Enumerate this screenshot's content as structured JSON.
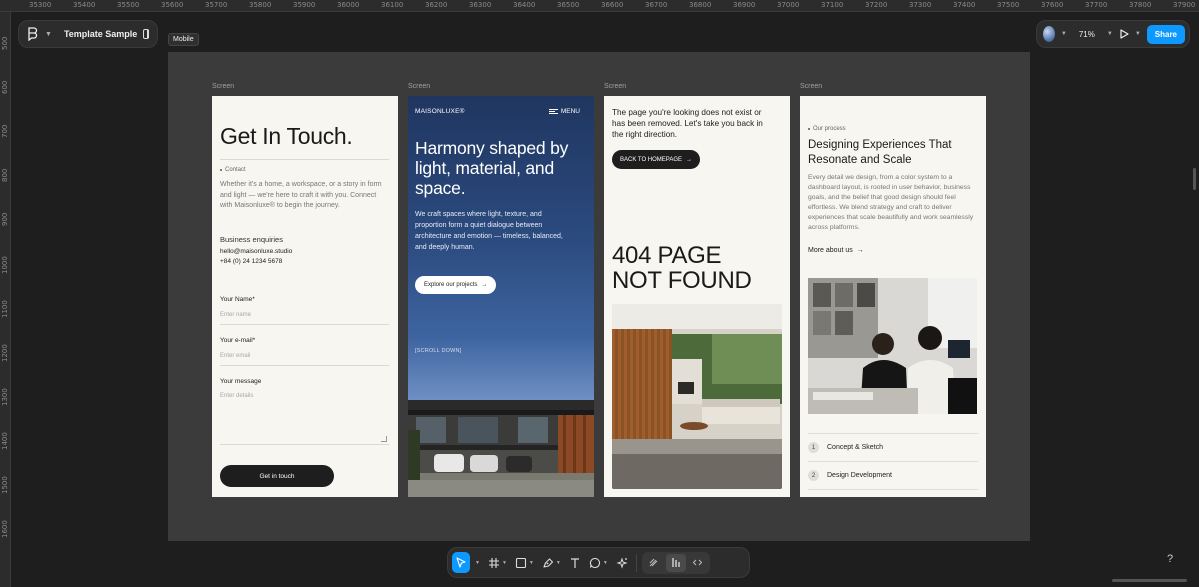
{
  "ruler": {
    "top": [
      "35300",
      "35400",
      "35500",
      "35600",
      "35700",
      "35800",
      "35900",
      "36000",
      "36100",
      "36200",
      "36300",
      "36400",
      "36500",
      "36600",
      "36700",
      "36800",
      "36900",
      "37000",
      "37100",
      "37200",
      "37300",
      "37400",
      "37500",
      "37600",
      "37700",
      "37800",
      "37900"
    ],
    "left": [
      "500",
      "600",
      "700",
      "800",
      "900",
      "1000",
      "1100",
      "1200",
      "1300",
      "1400",
      "1500",
      "1600"
    ]
  },
  "file": {
    "title": "Template Sample",
    "logo_icon": "figma-menu-icon"
  },
  "tooltip": "Mobile",
  "header_right": {
    "zoom": "71%",
    "share_label": "Share",
    "accent": "#0d99ff"
  },
  "screens": {
    "labels": [
      "Screen",
      "Screen",
      "Screen",
      "Screen"
    ],
    "contact": {
      "title": "Get In Touch.",
      "tag": "Contact",
      "description": "Whether it's a home, a workspace, or a story in form and light — we're here to craft it with you. Connect with Maisonluxe® to begin the journey.",
      "biz_label": "Business enquiries",
      "email": "hello@maisonluxe.studio",
      "phone": "+84 (0) 24 1234 5678",
      "name_label": "Your Name*",
      "name_placeholder": "Enter name",
      "email_label": "Your e-mail*",
      "email_placeholder": "Enter email",
      "message_label": "Your message",
      "message_placeholder": "Enter details",
      "button": "Get in touch"
    },
    "hero": {
      "brand": "MAISONLUXE®",
      "menu": "MENU",
      "headline": "Harmony shaped by light, material, and space.",
      "sub": "We craft spaces where light, texture, and proportion form a quiet dialogue between architecture and emotion — timeless, balanced, and deeply human.",
      "button": "Explore our projects",
      "scroll": "[SCROLL DOWN]"
    },
    "notfound": {
      "message": "The page you're looking does not exist or has been removed. Let's take you back in the right direction.",
      "button": "BACK TO HOMEPAGE",
      "line1": "404 PAGE",
      "line2": "NOT FOUND"
    },
    "process": {
      "tag": "Our process",
      "headline": "Designing Experiences That Resonate and Scale",
      "body": "Every detail we design, from a color system to a dashboard layout, is rooted in user behavior, business goals, and the belief that good design should feel effortless. We blend strategy and craft to deliver experiences that scale beautifully and work seamlessly across platforms.",
      "more": "More about us",
      "steps": [
        {
          "num": "1",
          "label": "Concept & Sketch"
        },
        {
          "num": "2",
          "label": "Design Development"
        }
      ]
    }
  },
  "help": "?"
}
